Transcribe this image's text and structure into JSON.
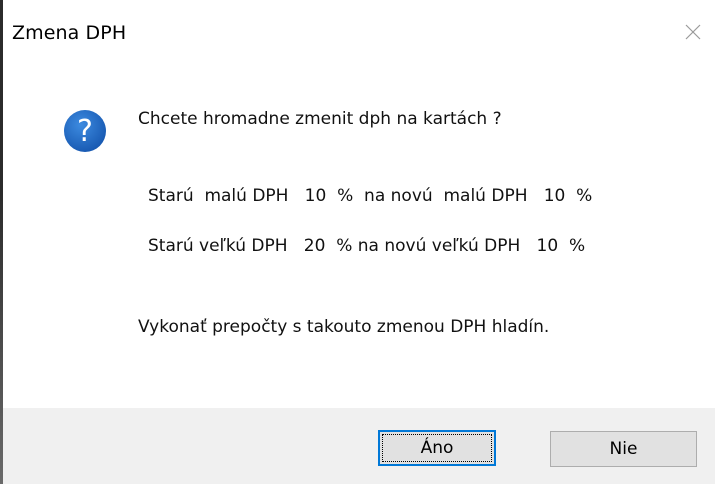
{
  "dialog": {
    "title": "Zmena DPH",
    "close_icon": "close-icon",
    "icon": "question-icon",
    "colors": {
      "icon_blue": "#1a64c0",
      "footer_bg": "#f0f0f0",
      "focus_border": "#0078d7"
    },
    "message": {
      "question": "Chcete hromadne zmenit dph na kartách ?",
      "small_rate_line": "Starú  malú DPH   10  %  na novú  malú DPH   10  %",
      "large_rate_line": "Starú veľkú DPH   20  % na novú veľkú DPH   10  %",
      "confirm_line": "Vykonať prepočty s takouto zmenou DPH hladín."
    },
    "buttons": {
      "yes_label": "Áno",
      "no_label": "Nie"
    }
  }
}
